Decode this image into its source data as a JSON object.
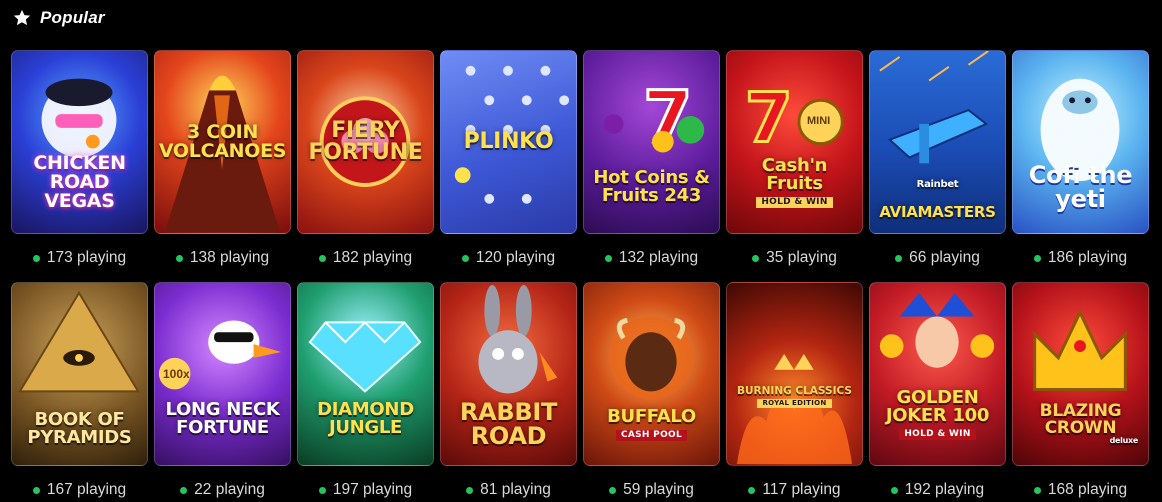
{
  "section": {
    "icon": "star-icon",
    "title": "Popular"
  },
  "colors": {
    "background": "#000000",
    "online_dot": "#22c55e",
    "count_text": "#d9d9d9"
  },
  "rows": [
    [
      {
        "title": "CHICKEN ROAD Vegas",
        "count": "173 playing"
      },
      {
        "title": "3 COIN VOLCANOES",
        "count": "138 playing"
      },
      {
        "title": "FIERY FORTUNE",
        "count": "182 playing"
      },
      {
        "title": "PLINKO",
        "count": "120 playing"
      },
      {
        "title": "Hot Coins & Fruits 243",
        "count": "132 playing"
      },
      {
        "title": "Cash'n Fruits",
        "subtitle": "HOLD & WIN",
        "badge": "MINI",
        "count": "35 playing"
      },
      {
        "title": "AVIAMASTERS",
        "brand": "Rainbet",
        "count": "66 playing"
      },
      {
        "title": "Cofi the yeti",
        "count": "186 playing"
      }
    ],
    [
      {
        "title": "BOOK OF PYRAMIDS",
        "count": "167 playing"
      },
      {
        "title": "LONG NECK FORTUNE",
        "badge": "100x",
        "count": "22 playing"
      },
      {
        "title": "DIAMOND JUNGLE",
        "count": "197 playing"
      },
      {
        "title": "RABBIT ROAD",
        "count": "81 playing"
      },
      {
        "title": "BUFFALO",
        "subtitle": "CASH POOL",
        "count": "59 playing"
      },
      {
        "title": "BURNING CLASSICS",
        "subtitle": "ROYAL EDITION",
        "count": "117 playing"
      },
      {
        "title": "GOLDEN JOKER 100",
        "subtitle": "HOLD & WIN",
        "count": "192 playing"
      },
      {
        "title": "BLAZING CROWN",
        "subtitle": "deluxe",
        "count": "168 playing"
      }
    ]
  ]
}
